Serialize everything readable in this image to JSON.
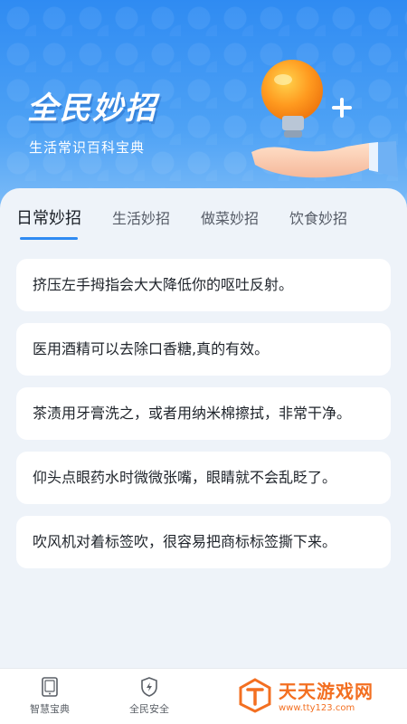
{
  "hero": {
    "title": "全民妙招",
    "subtitle": "生活常识百科宝典"
  },
  "tabs": [
    {
      "label": "日常妙招",
      "active": true
    },
    {
      "label": "生活妙招",
      "active": false
    },
    {
      "label": "做菜妙招",
      "active": false
    },
    {
      "label": "饮食妙招",
      "active": false
    }
  ],
  "tips": [
    "挤压左手拇指会大大降低你的呕吐反射。",
    "医用酒精可以去除口香糖,真的有效。",
    "茶渍用牙膏洗之，或者用纳米棉擦拭，非常干净。",
    "仰头点眼药水时微微张嘴，眼睛就不会乱眨了。",
    "吹风机对着标签吹，很容易把商标标签撕下来。"
  ],
  "bottom_nav": [
    {
      "label": "智慧宝典",
      "icon": "book-icon"
    },
    {
      "label": "全民安全",
      "icon": "shield-icon"
    }
  ],
  "watermark": {
    "main": "天天游戏网",
    "sub": "www.tty123.com"
  },
  "colors": {
    "accent": "#2f8bf2",
    "watermark": "#f36f21"
  }
}
